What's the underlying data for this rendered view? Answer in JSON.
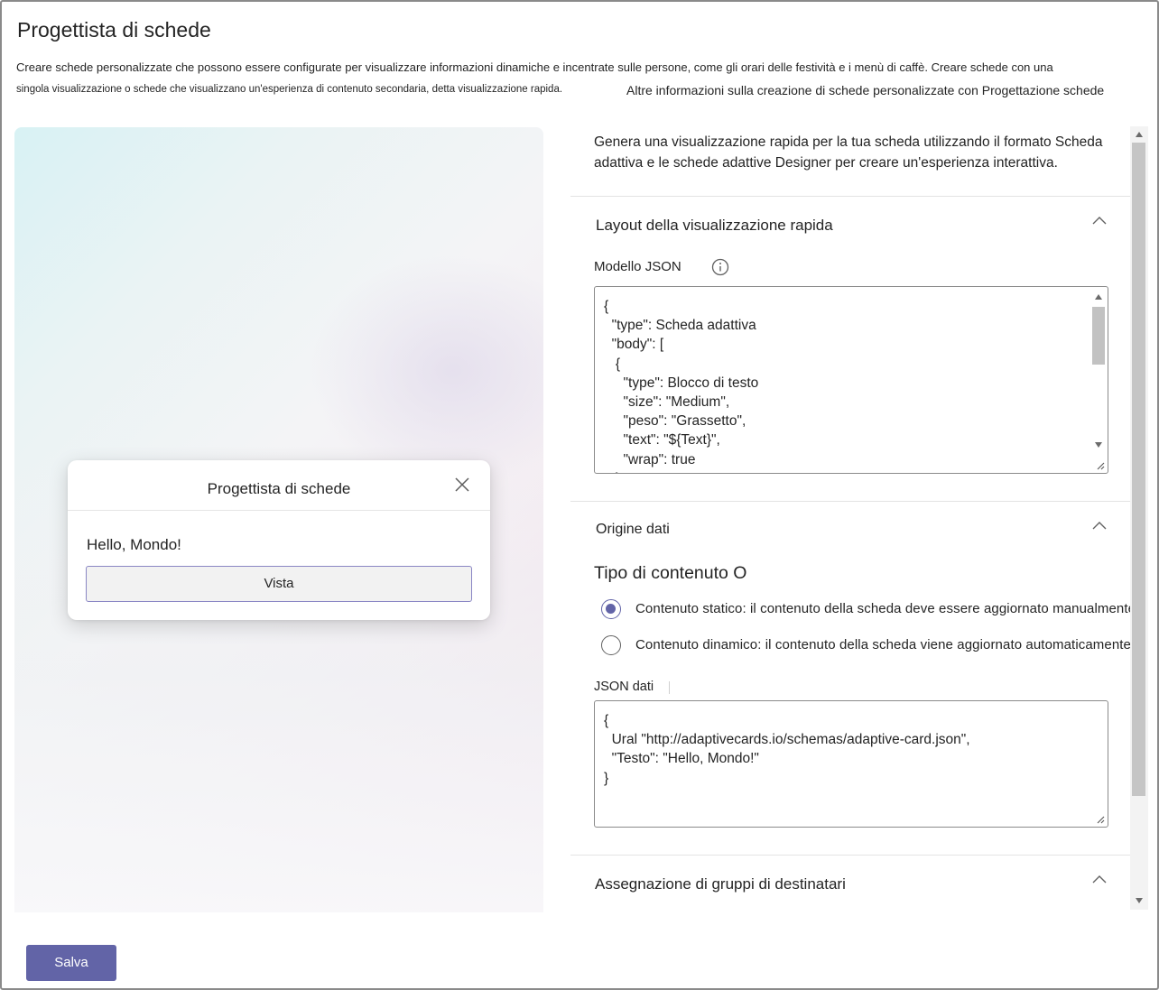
{
  "page": {
    "title": "Progettista di schede",
    "description_line1": "Creare schede personalizzate che possono essere configurate per visualizzare informazioni dinamiche e incentrate sulle persone, come gli orari delle festività e i menù di caffè. Creare schede con una",
    "description_line2": "singola visualizzazione o schede che visualizzano un'esperienza di contenuto secondaria, detta visualizzazione rapida.",
    "learn_more_link": "Altre informazioni sulla creazione di schede personalizzate con Progettazione schede"
  },
  "preview": {
    "card_title": "Progettista di schede",
    "card_text": "Hello, Mondo!",
    "card_button": "Vista"
  },
  "panel": {
    "intro": "Genera una visualizzazione rapida per la tua scheda utilizzando il formato Scheda adattiva e le schede adattive Designer per creare un'esperienza interattiva.",
    "quick_view_section": {
      "heading": "Layout della visualizzazione rapida",
      "json_label": "Modello JSON",
      "json_template": "{\n  \"type\": Scheda adattiva\n  \"body\": [\n   {\n     \"type\": Blocco di testo\n     \"size\": \"Medium\",\n     \"peso\": \"Grassetto\",\n     \"text\": \"${Text}\",\n     \"wrap\": true\n   }"
    },
    "data_source_section": {
      "heading": "Origine dati",
      "content_type_title": "Tipo di contenuto O",
      "options": [
        {
          "label": "Contenuto statico: il contenuto della scheda deve essere aggiornato manualmente",
          "selected": true
        },
        {
          "label": "Contenuto dinamico: il contenuto della scheda viene aggiornato automaticamente",
          "selected": false
        }
      ],
      "data_json_label": "JSON dati",
      "data_json": "{\n  Ural \"http://adaptivecards.io/schemas/adaptive-card.json\",\n  \"Testo\": \"Hello, Mondo!\"\n}"
    },
    "audience_section": {
      "heading": "Assegnazione di gruppi di destinatari"
    }
  },
  "footer": {
    "save_label": "Salva"
  },
  "colors": {
    "accent": "#6264a7",
    "text": "#242424",
    "border": "#8a8a8a"
  },
  "icons": {
    "close": "close-icon",
    "info": "info-icon",
    "chevron": "chevron-up-icon"
  }
}
